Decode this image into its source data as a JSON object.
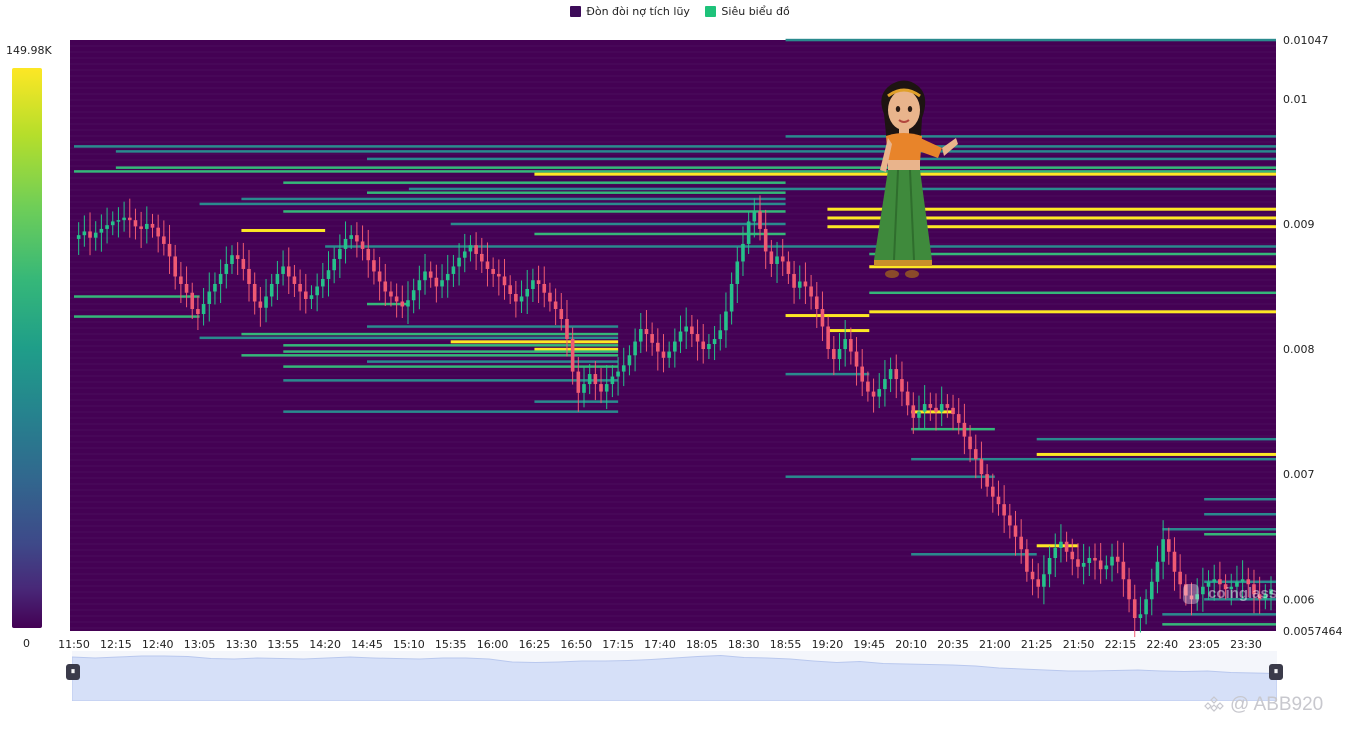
{
  "legend": [
    {
      "label": "Đòn đòi nợ tích lũy",
      "color": "#3d0c59"
    },
    {
      "label": "Siêu biểu đồ",
      "color": "#1ec27a"
    }
  ],
  "colorbar": {
    "max_label": "149.98K",
    "min_label": "0",
    "max_value": 149980,
    "min_value": 0
  },
  "watermark": "coinglass",
  "brand": "@ ABB920",
  "colors": {
    "heatmap_bg": "#440154",
    "up_candle": "#26c08a",
    "down_candle": "#ef5a72",
    "level_low": "#2a8a8e",
    "level_mid": "#35b779",
    "level_high": "#fde725"
  },
  "navigator": {
    "handle_left_icon": "pause-handle",
    "handle_right_icon": "pause-handle"
  },
  "chart_data": {
    "type": "heatmap",
    "title": "",
    "xlabel": "",
    "ylabel": "",
    "y_range": [
      0.0057464,
      0.01047
    ],
    "x_ticks": [
      "11:50",
      "12:15",
      "12:40",
      "13:05",
      "13:30",
      "13:55",
      "14:20",
      "14:45",
      "15:10",
      "15:35",
      "16:00",
      "16:25",
      "16:50",
      "17:15",
      "17:40",
      "18:05",
      "18:30",
      "18:55",
      "19:20",
      "19:45",
      "20:10",
      "20:35",
      "21:00",
      "21:25",
      "21:50",
      "22:15",
      "22:40",
      "23:05",
      "23:30"
    ],
    "y_ticks": [
      {
        "value": 0.01047,
        "label": "0.01047"
      },
      {
        "value": 0.01,
        "label": "0.01"
      },
      {
        "value": 0.009,
        "label": "0.009"
      },
      {
        "value": 0.008,
        "label": "0.008"
      },
      {
        "value": 0.007,
        "label": "0.007"
      },
      {
        "value": 0.006,
        "label": "0.006"
      },
      {
        "value": 0.0057464,
        "label": "0.0057464"
      }
    ],
    "close_series": [
      0.00888,
      0.00891,
      0.00894,
      0.00889,
      0.00893,
      0.00896,
      0.00899,
      0.00902,
      0.00903,
      0.00905,
      0.00903,
      0.00898,
      0.00896,
      0.009,
      0.00897,
      0.0089,
      0.00884,
      0.00874,
      0.00858,
      0.00852,
      0.00845,
      0.00832,
      0.00828,
      0.00836,
      0.00846,
      0.00852,
      0.0086,
      0.00868,
      0.00875,
      0.00872,
      0.00864,
      0.00852,
      0.00838,
      0.00833,
      0.00842,
      0.00852,
      0.0086,
      0.00866,
      0.00858,
      0.00852,
      0.00846,
      0.0084,
      0.00843,
      0.0085,
      0.00856,
      0.00863,
      0.00872,
      0.0088,
      0.00888,
      0.00891,
      0.00886,
      0.0088,
      0.00871,
      0.00862,
      0.00854,
      0.00846,
      0.00842,
      0.00838,
      0.00834,
      0.00839,
      0.00847,
      0.00855,
      0.00862,
      0.00857,
      0.0085,
      0.00855,
      0.0086,
      0.00866,
      0.00873,
      0.00878,
      0.00883,
      0.00876,
      0.0087,
      0.00864,
      0.0086,
      0.00858,
      0.00851,
      0.00844,
      0.00838,
      0.00842,
      0.00848,
      0.00855,
      0.00852,
      0.00845,
      0.00838,
      0.00832,
      0.00824,
      0.00808,
      0.00782,
      0.00765,
      0.00772,
      0.0078,
      0.00772,
      0.00766,
      0.00772,
      0.00778,
      0.00782,
      0.00787,
      0.00795,
      0.00806,
      0.00816,
      0.00812,
      0.00805,
      0.00798,
      0.00793,
      0.00798,
      0.00806,
      0.00814,
      0.00818,
      0.00812,
      0.00806,
      0.008,
      0.00804,
      0.00808,
      0.00815,
      0.0083,
      0.00852,
      0.0087,
      0.00884,
      0.00902,
      0.0091,
      0.00896,
      0.00878,
      0.00868,
      0.00874,
      0.0087,
      0.0086,
      0.00849,
      0.00854,
      0.0085,
      0.00842,
      0.00832,
      0.00818,
      0.008,
      0.00792,
      0.008,
      0.00808,
      0.00798,
      0.00786,
      0.00774,
      0.00766,
      0.00762,
      0.00768,
      0.00776,
      0.00784,
      0.00776,
      0.00766,
      0.00755,
      0.00745,
      0.0075,
      0.00756,
      0.00753,
      0.0075,
      0.00756,
      0.00753,
      0.00748,
      0.00741,
      0.0073,
      0.0072,
      0.00712,
      0.007,
      0.0069,
      0.00682,
      0.00676,
      0.00667,
      0.00659,
      0.0065,
      0.0064,
      0.00622,
      0.00616,
      0.0061,
      0.0062,
      0.00633,
      0.00641,
      0.00646,
      0.00638,
      0.00632,
      0.00626,
      0.00629,
      0.00633,
      0.00631,
      0.00624,
      0.00627,
      0.00634,
      0.0063,
      0.00616,
      0.006,
      0.00585,
      0.00588,
      0.006,
      0.00614,
      0.0063,
      0.00648,
      0.00638,
      0.00622,
      0.00612,
      0.00603,
      0.006,
      0.00604,
      0.0061,
      0.00614,
      0.00616,
      0.00612,
      0.00608,
      0.0061,
      0.00614,
      0.00616,
      0.00612,
      0.00604,
      0.006,
      0.00604,
      0.00608
    ],
    "liquidation_levels": [
      {
        "price": 0.01047,
        "start": "18:55",
        "end": "23:59",
        "intensity": "low"
      },
      {
        "price": 0.0097,
        "start": "18:55",
        "end": "23:59",
        "intensity": "low"
      },
      {
        "price": 0.00962,
        "start": "11:50",
        "end": "23:59",
        "intensity": "low"
      },
      {
        "price": 0.00958,
        "start": "12:15",
        "end": "23:59",
        "intensity": "low"
      },
      {
        "price": 0.00952,
        "start": "14:45",
        "end": "23:59",
        "intensity": "low"
      },
      {
        "price": 0.00945,
        "start": "12:15",
        "end": "23:59",
        "intensity": "mid"
      },
      {
        "price": 0.00942,
        "start": "11:50",
        "end": "23:59",
        "intensity": "mid"
      },
      {
        "price": 0.0094,
        "start": "16:25",
        "end": "23:59",
        "intensity": "high"
      },
      {
        "price": 0.00933,
        "start": "13:55",
        "end": "18:55",
        "intensity": "mid"
      },
      {
        "price": 0.00928,
        "start": "15:10",
        "end": "23:59",
        "intensity": "low"
      },
      {
        "price": 0.00925,
        "start": "14:45",
        "end": "18:55",
        "intensity": "mid"
      },
      {
        "price": 0.0092,
        "start": "13:30",
        "end": "18:55",
        "intensity": "low"
      },
      {
        "price": 0.00916,
        "start": "13:05",
        "end": "18:55",
        "intensity": "low"
      },
      {
        "price": 0.00912,
        "start": "19:20",
        "end": "23:59",
        "intensity": "high"
      },
      {
        "price": 0.0091,
        "start": "13:55",
        "end": "18:55",
        "intensity": "mid"
      },
      {
        "price": 0.00905,
        "start": "19:20",
        "end": "23:59",
        "intensity": "high"
      },
      {
        "price": 0.009,
        "start": "15:35",
        "end": "18:55",
        "intensity": "low"
      },
      {
        "price": 0.00898,
        "start": "19:20",
        "end": "23:59",
        "intensity": "high"
      },
      {
        "price": 0.00895,
        "start": "13:30",
        "end": "14:20",
        "intensity": "high"
      },
      {
        "price": 0.00892,
        "start": "16:25",
        "end": "18:55",
        "intensity": "mid"
      },
      {
        "price": 0.00882,
        "start": "14:20",
        "end": "23:59",
        "intensity": "low"
      },
      {
        "price": 0.00876,
        "start": "19:45",
        "end": "23:59",
        "intensity": "mid"
      },
      {
        "price": 0.00866,
        "start": "19:45",
        "end": "23:59",
        "intensity": "high"
      },
      {
        "price": 0.00845,
        "start": "19:45",
        "end": "23:59",
        "intensity": "mid"
      },
      {
        "price": 0.00842,
        "start": "11:50",
        "end": "13:05",
        "intensity": "mid"
      },
      {
        "price": 0.00836,
        "start": "14:45",
        "end": "15:10",
        "intensity": "mid"
      },
      {
        "price": 0.0083,
        "start": "19:45",
        "end": "23:59",
        "intensity": "high"
      },
      {
        "price": 0.00827,
        "start": "18:55",
        "end": "19:45",
        "intensity": "high"
      },
      {
        "price": 0.00826,
        "start": "11:50",
        "end": "13:05",
        "intensity": "mid"
      },
      {
        "price": 0.00818,
        "start": "14:45",
        "end": "17:15",
        "intensity": "low"
      },
      {
        "price": 0.00815,
        "start": "19:20",
        "end": "19:45",
        "intensity": "high"
      },
      {
        "price": 0.00812,
        "start": "13:30",
        "end": "17:15",
        "intensity": "mid"
      },
      {
        "price": 0.00809,
        "start": "13:05",
        "end": "17:15",
        "intensity": "low"
      },
      {
        "price": 0.00806,
        "start": "15:35",
        "end": "17:15",
        "intensity": "high"
      },
      {
        "price": 0.00803,
        "start": "13:55",
        "end": "17:15",
        "intensity": "mid"
      },
      {
        "price": 0.008,
        "start": "16:25",
        "end": "17:15",
        "intensity": "high"
      },
      {
        "price": 0.00798,
        "start": "13:55",
        "end": "17:15",
        "intensity": "mid"
      },
      {
        "price": 0.00795,
        "start": "13:30",
        "end": "17:15",
        "intensity": "mid"
      },
      {
        "price": 0.0079,
        "start": "14:45",
        "end": "17:15",
        "intensity": "low"
      },
      {
        "price": 0.00786,
        "start": "13:55",
        "end": "17:15",
        "intensity": "mid"
      },
      {
        "price": 0.0078,
        "start": "18:55",
        "end": "19:45",
        "intensity": "low"
      },
      {
        "price": 0.00775,
        "start": "13:55",
        "end": "17:15",
        "intensity": "low"
      },
      {
        "price": 0.00758,
        "start": "16:25",
        "end": "17:15",
        "intensity": "low"
      },
      {
        "price": 0.0075,
        "start": "13:55",
        "end": "17:15",
        "intensity": "low"
      },
      {
        "price": 0.0075,
        "start": "20:10",
        "end": "20:35",
        "intensity": "high"
      },
      {
        "price": 0.00736,
        "start": "20:10",
        "end": "21:00",
        "intensity": "mid"
      },
      {
        "price": 0.00728,
        "start": "21:25",
        "end": "23:59",
        "intensity": "low"
      },
      {
        "price": 0.00716,
        "start": "21:25",
        "end": "23:59",
        "intensity": "high"
      },
      {
        "price": 0.00712,
        "start": "20:10",
        "end": "23:59",
        "intensity": "low"
      },
      {
        "price": 0.00698,
        "start": "18:55",
        "end": "21:00",
        "intensity": "low"
      },
      {
        "price": 0.0068,
        "start": "23:05",
        "end": "23:59",
        "intensity": "low"
      },
      {
        "price": 0.00668,
        "start": "23:05",
        "end": "23:59",
        "intensity": "low"
      },
      {
        "price": 0.00656,
        "start": "22:40",
        "end": "23:59",
        "intensity": "low"
      },
      {
        "price": 0.00652,
        "start": "23:05",
        "end": "23:59",
        "intensity": "mid"
      },
      {
        "price": 0.00643,
        "start": "21:25",
        "end": "21:50",
        "intensity": "high"
      },
      {
        "price": 0.00636,
        "start": "20:10",
        "end": "21:25",
        "intensity": "low"
      },
      {
        "price": 0.00614,
        "start": "23:05",
        "end": "23:59",
        "intensity": "low"
      },
      {
        "price": 0.006,
        "start": "23:05",
        "end": "23:59",
        "intensity": "low"
      },
      {
        "price": 0.00588,
        "start": "22:40",
        "end": "23:59",
        "intensity": "low"
      },
      {
        "price": 0.0058,
        "start": "22:40",
        "end": "23:59",
        "intensity": "mid"
      }
    ],
    "navigator_series": [
      0.88,
      0.86,
      0.88,
      0.9,
      0.9,
      0.89,
      0.85,
      0.84,
      0.86,
      0.85,
      0.84,
      0.86,
      0.88,
      0.86,
      0.85,
      0.84,
      0.86,
      0.86,
      0.84,
      0.78,
      0.77,
      0.78,
      0.8,
      0.8,
      0.81,
      0.83,
      0.86,
      0.89,
      0.91,
      0.87,
      0.86,
      0.84,
      0.8,
      0.77,
      0.79,
      0.75,
      0.74,
      0.73,
      0.72,
      0.7,
      0.66,
      0.64,
      0.62,
      0.6,
      0.6,
      0.61,
      0.62,
      0.6,
      0.59,
      0.6,
      0.57,
      0.56,
      0.55
    ]
  }
}
